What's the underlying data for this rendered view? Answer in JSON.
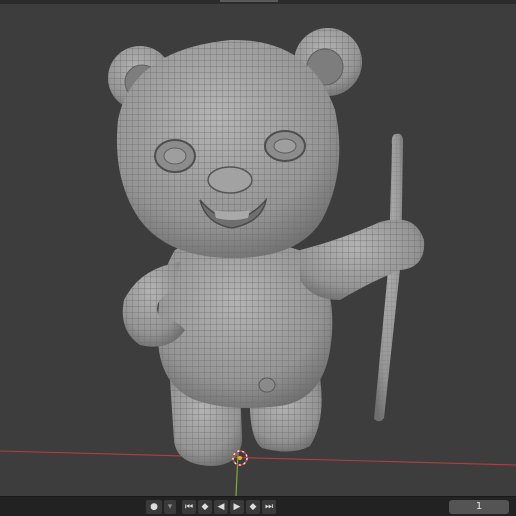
{
  "viewport": {
    "subject": "Stylized bear character sculpt with wireframe overlay holding a staff",
    "x_axis_color": "#c0404a",
    "y_axis_color": "#7bb33a",
    "background_color": "#3d3d3d",
    "mesh_color": "#9a9a9a"
  },
  "timeline": {
    "current_frame": "1",
    "keyframe_icon": "keyframe-dot-icon",
    "dropdown_icon": "chevron-down-icon",
    "controls": [
      {
        "name": "jump-to-start-icon",
        "glyph": "⏮"
      },
      {
        "name": "prev-keyframe-icon",
        "glyph": "◆"
      },
      {
        "name": "play-reverse-icon",
        "glyph": "◀"
      },
      {
        "name": "play-icon",
        "glyph": "▶"
      },
      {
        "name": "next-keyframe-icon",
        "glyph": "◆"
      },
      {
        "name": "jump-to-end-icon",
        "glyph": "⏭"
      }
    ]
  }
}
